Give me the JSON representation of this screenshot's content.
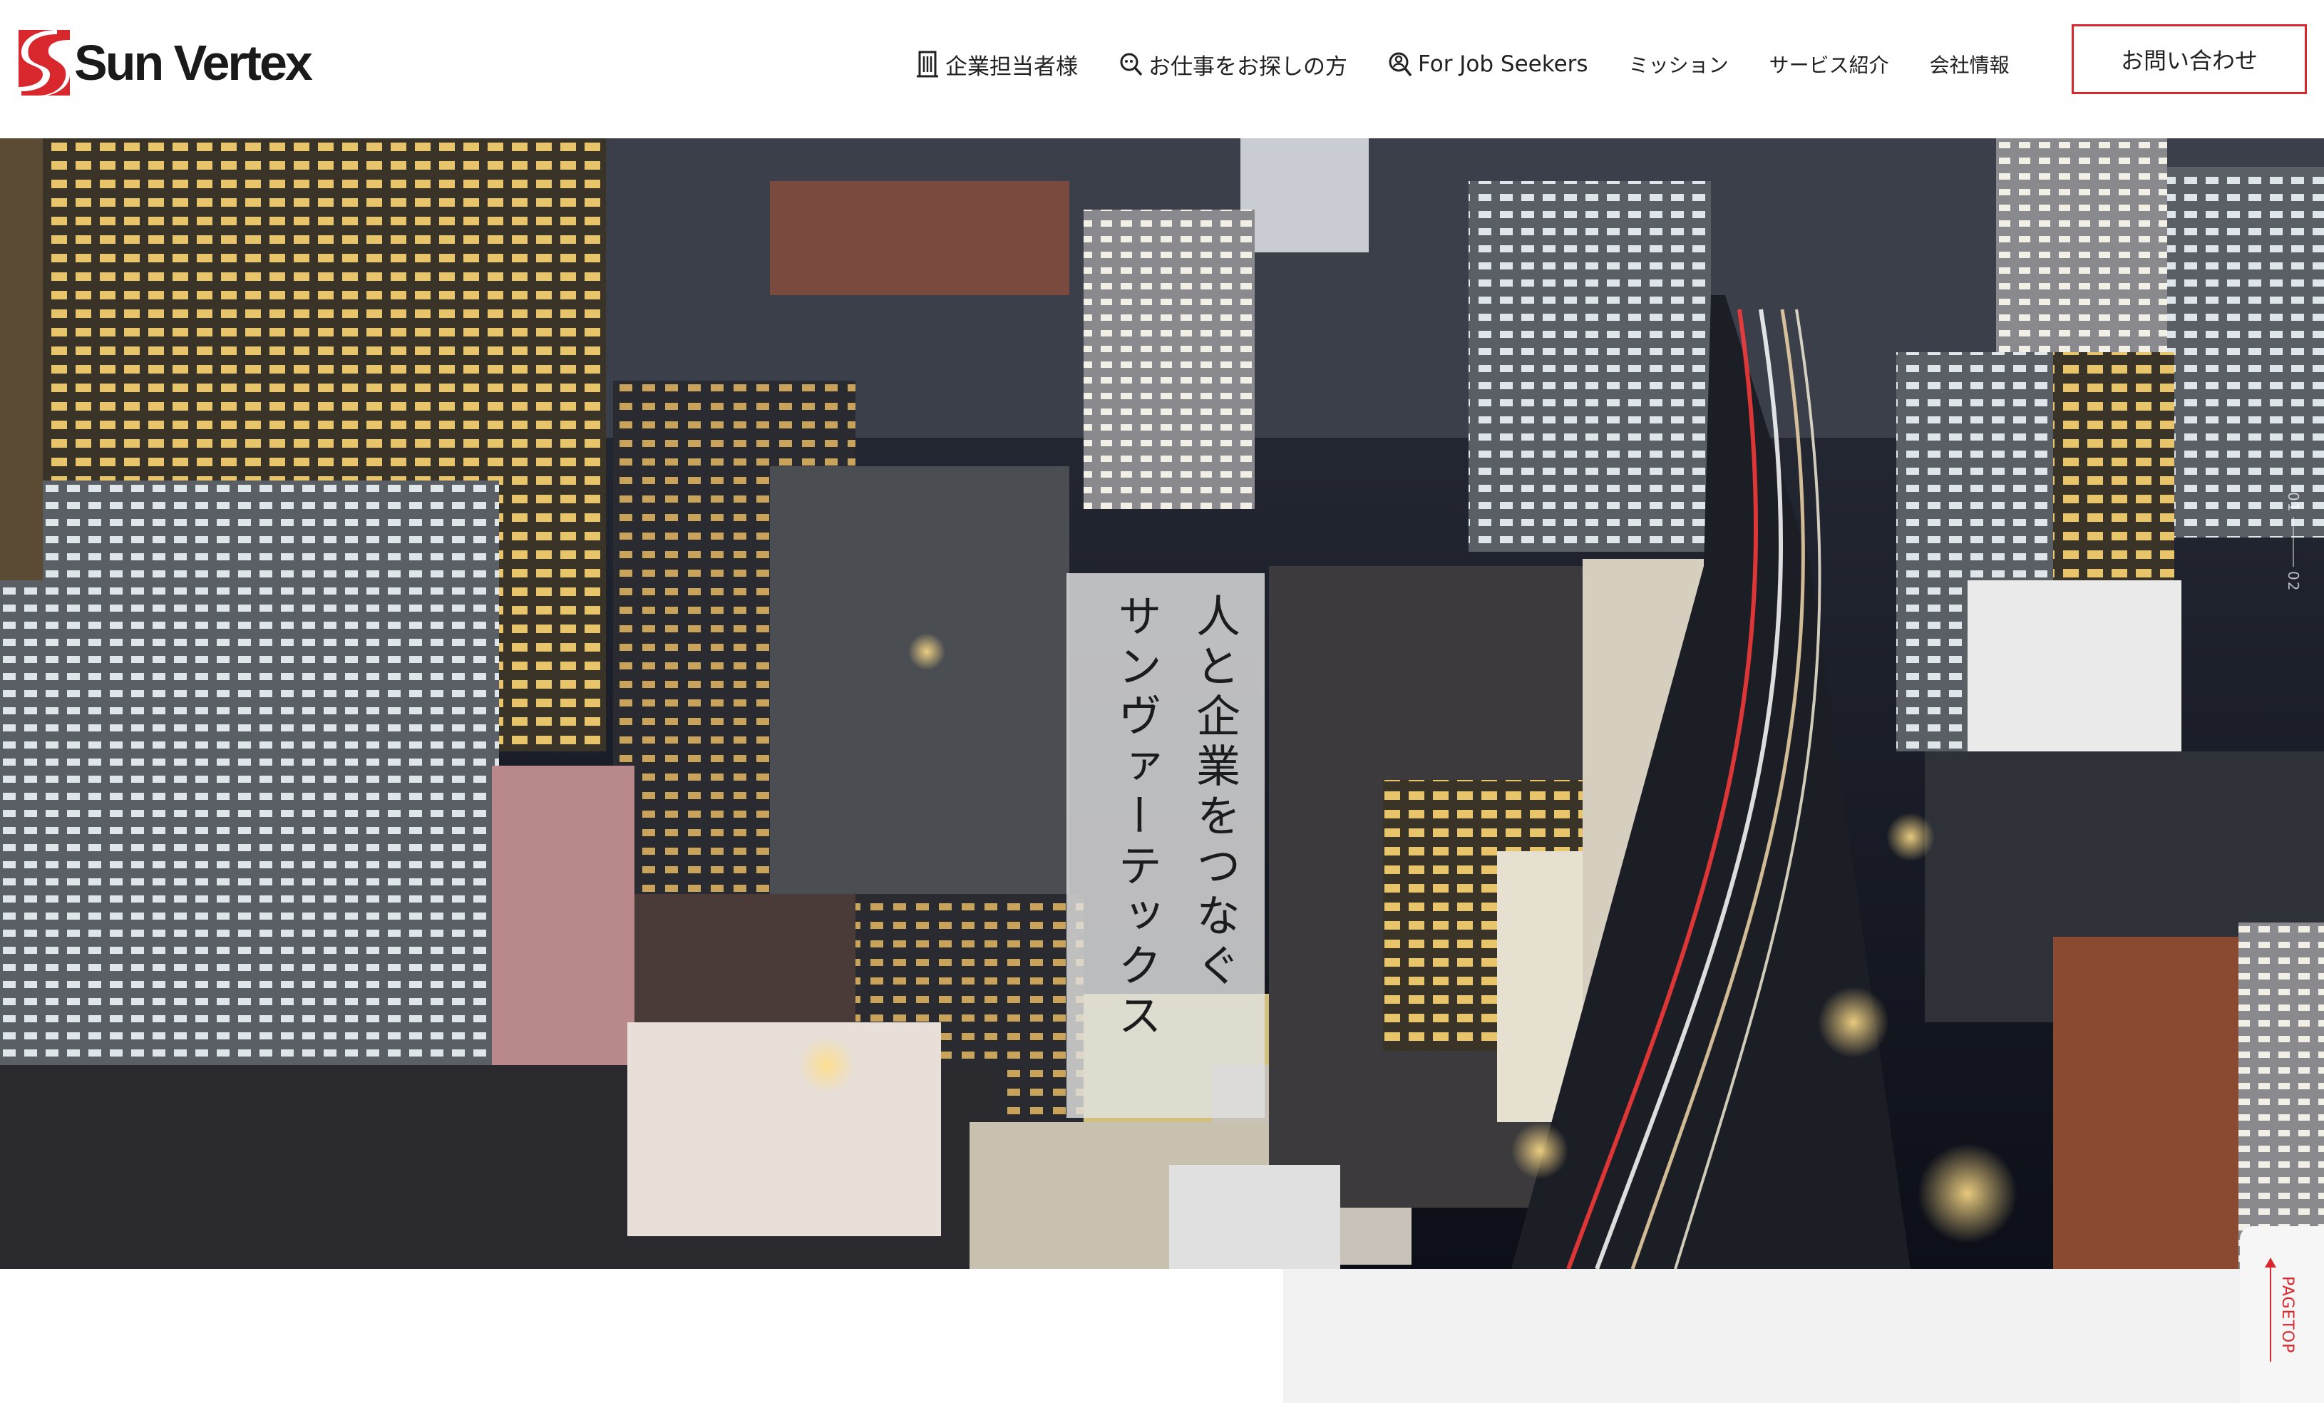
{
  "header": {
    "logo_text": "Sun Vertex",
    "nav": [
      {
        "label": "企業担当者様",
        "icon": "building-icon"
      },
      {
        "label": "お仕事をお探しの方",
        "icon": "job-search-icon"
      },
      {
        "label": "For Job Seekers",
        "icon": "person-search-icon"
      },
      {
        "label": "ミッション"
      },
      {
        "label": "サービス紹介"
      },
      {
        "label": "会社情報"
      }
    ],
    "contact_label": "お問い合わせ"
  },
  "hero": {
    "tagline_line1": "人と企業をつなぐ",
    "tagline_line2": "サンヴァーテックス",
    "slide_current": "01",
    "slide_next": "02"
  },
  "pagetop_label": "PAGETOP",
  "colors": {
    "accent": "#d9272e",
    "text": "#222222"
  }
}
